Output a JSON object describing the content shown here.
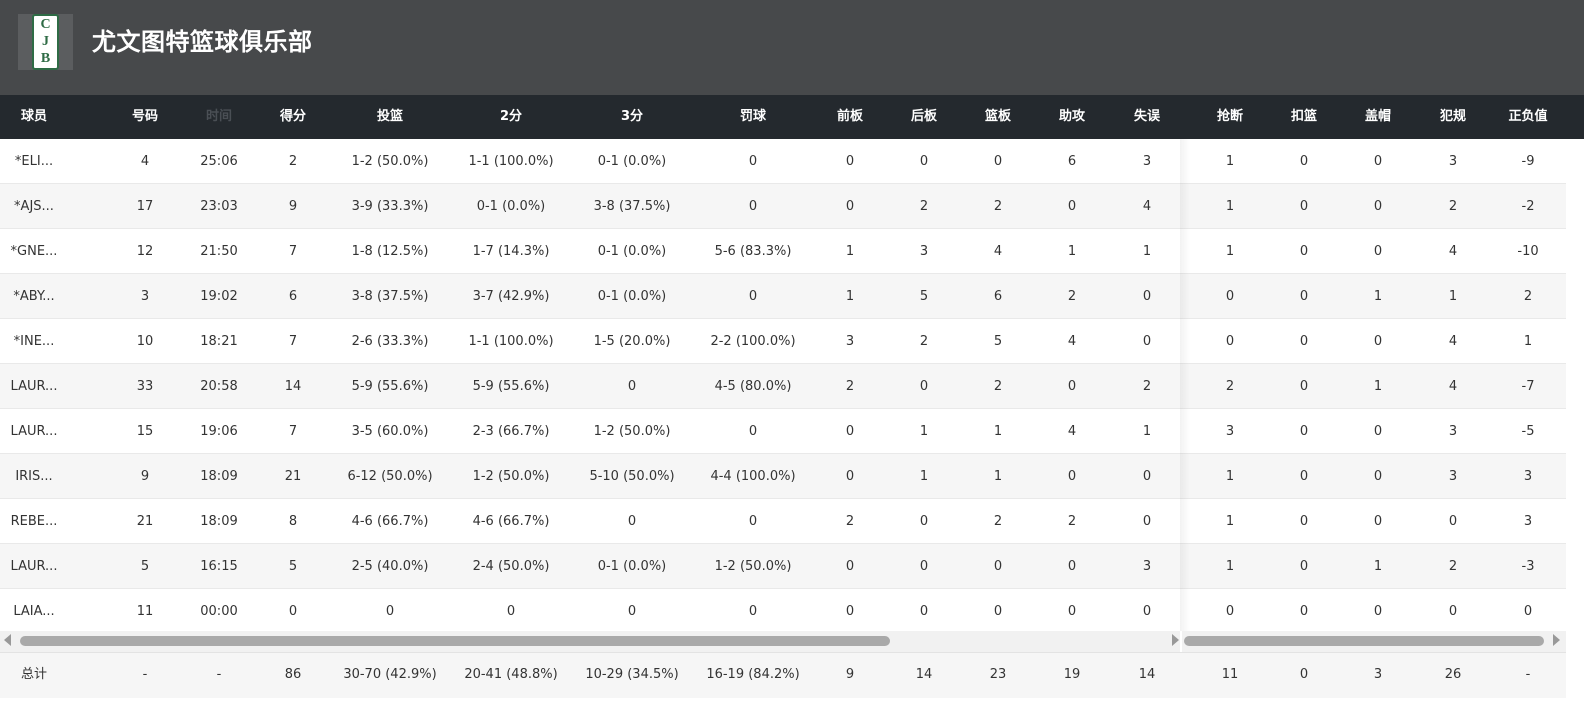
{
  "team": {
    "name": "尤文图特篮球俱乐部",
    "logo_letters": [
      "C",
      "J",
      "B"
    ]
  },
  "columns": [
    "球员",
    "号码",
    "时间",
    "得分",
    "投篮",
    "2分",
    "3分",
    "罚球",
    "前板",
    "后板",
    "篮板",
    "助攻",
    "失误",
    "抢断",
    "扣篮",
    "盖帽",
    "犯规",
    "正负值"
  ],
  "rows": [
    [
      "*ELI...",
      "4",
      "25:06",
      "2",
      "1-2 (50.0%)",
      "1-1 (100.0%)",
      "0-1 (0.0%)",
      "0",
      "0",
      "0",
      "0",
      "6",
      "3",
      "1",
      "0",
      "0",
      "3",
      "-9"
    ],
    [
      "*AJS...",
      "17",
      "23:03",
      "9",
      "3-9 (33.3%)",
      "0-1 (0.0%)",
      "3-8 (37.5%)",
      "0",
      "0",
      "2",
      "2",
      "0",
      "4",
      "1",
      "0",
      "0",
      "2",
      "-2"
    ],
    [
      "*GNE...",
      "12",
      "21:50",
      "7",
      "1-8 (12.5%)",
      "1-7 (14.3%)",
      "0-1 (0.0%)",
      "5-6 (83.3%)",
      "1",
      "3",
      "4",
      "1",
      "1",
      "1",
      "0",
      "0",
      "4",
      "-10"
    ],
    [
      "*ABY...",
      "3",
      "19:02",
      "6",
      "3-8 (37.5%)",
      "3-7 (42.9%)",
      "0-1 (0.0%)",
      "0",
      "1",
      "5",
      "6",
      "2",
      "0",
      "0",
      "0",
      "1",
      "1",
      "2"
    ],
    [
      "*INE...",
      "10",
      "18:21",
      "7",
      "2-6 (33.3%)",
      "1-1 (100.0%)",
      "1-5 (20.0%)",
      "2-2 (100.0%)",
      "3",
      "2",
      "5",
      "4",
      "0",
      "0",
      "0",
      "0",
      "4",
      "1"
    ],
    [
      "LAUR...",
      "33",
      "20:58",
      "14",
      "5-9 (55.6%)",
      "5-9 (55.6%)",
      "0",
      "4-5 (80.0%)",
      "2",
      "0",
      "2",
      "0",
      "2",
      "2",
      "0",
      "1",
      "4",
      "-7"
    ],
    [
      "LAUR...",
      "15",
      "19:06",
      "7",
      "3-5 (60.0%)",
      "2-3 (66.7%)",
      "1-2 (50.0%)",
      "0",
      "0",
      "1",
      "1",
      "4",
      "1",
      "3",
      "0",
      "0",
      "3",
      "-5"
    ],
    [
      "IRIS...",
      "9",
      "18:09",
      "21",
      "6-12 (50.0%)",
      "1-2 (50.0%)",
      "5-10 (50.0%)",
      "4-4 (100.0%)",
      "0",
      "1",
      "1",
      "0",
      "0",
      "1",
      "0",
      "0",
      "3",
      "3"
    ],
    [
      "REBE...",
      "21",
      "18:09",
      "8",
      "4-6 (66.7%)",
      "4-6 (66.7%)",
      "0",
      "0",
      "2",
      "0",
      "2",
      "2",
      "0",
      "1",
      "0",
      "0",
      "0",
      "3"
    ],
    [
      "LAUR...",
      "5",
      "16:15",
      "5",
      "2-5 (40.0%)",
      "2-4 (50.0%)",
      "0-1 (0.0%)",
      "1-2 (50.0%)",
      "0",
      "0",
      "0",
      "0",
      "3",
      "1",
      "0",
      "1",
      "2",
      "-3"
    ],
    [
      "LAIA...",
      "11",
      "00:00",
      "0",
      "0",
      "0",
      "0",
      "0",
      "0",
      "0",
      "0",
      "0",
      "0",
      "0",
      "0",
      "0",
      "0",
      "0"
    ]
  ],
  "totals": [
    "总计",
    "-",
    "-",
    "86",
    "30-70 (42.9%)",
    "20-41 (48.8%)",
    "10-29 (34.5%)",
    "16-19 (84.2%)",
    "9",
    "14",
    "23",
    "19",
    "14",
    "11",
    "0",
    "3",
    "26",
    "-"
  ]
}
